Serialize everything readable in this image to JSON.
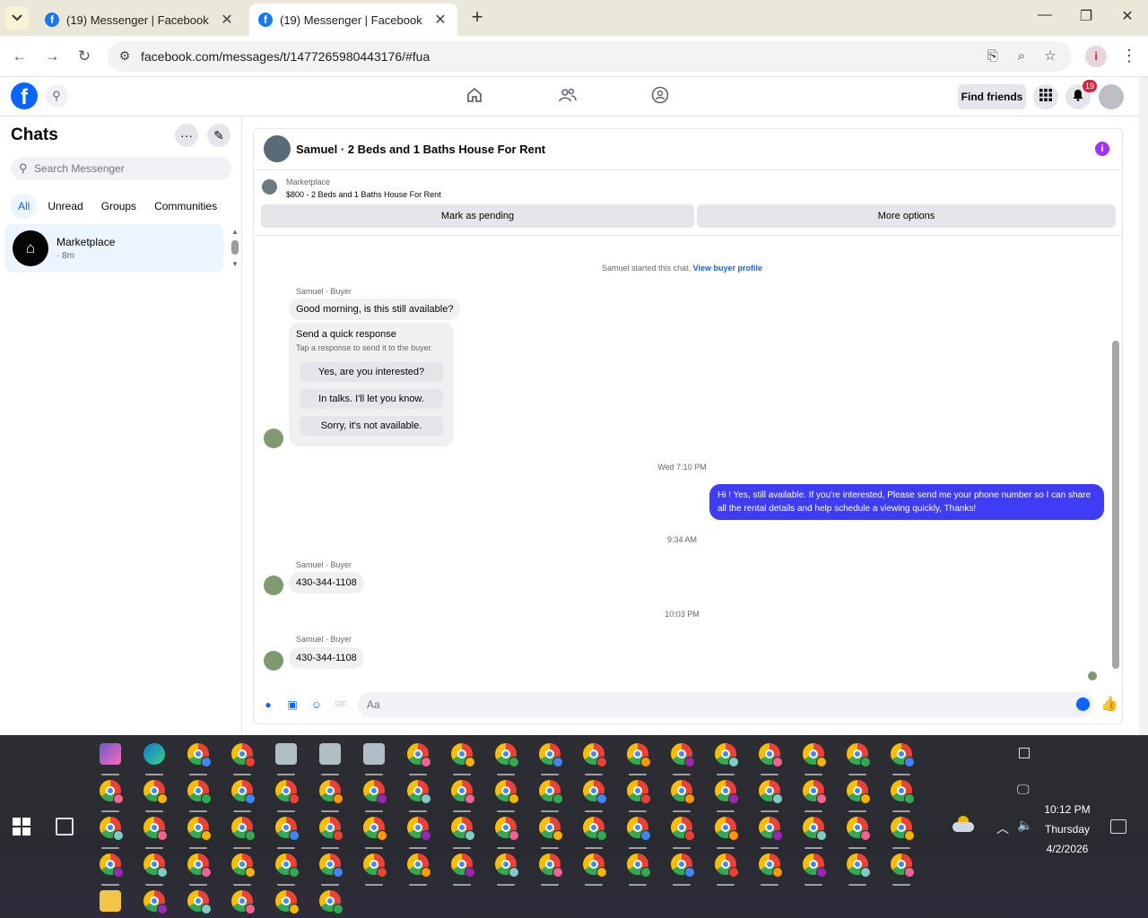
{
  "browser": {
    "tabs": [
      {
        "title": "(19) Messenger | Facebook",
        "active": false
      },
      {
        "title": "(19) Messenger | Facebook",
        "active": true
      }
    ],
    "url": "facebook.com/messages/t/1477265980443176/#fua",
    "new_tab": "+",
    "close": "✕"
  },
  "fb_header": {
    "logo": "f",
    "find_friends": "Find friends",
    "notification_count": "19",
    "nav_icons": [
      "home-icon",
      "friends-icon",
      "groups-icon"
    ]
  },
  "sidebar": {
    "title": "Chats",
    "search_placeholder": "Search Messenger",
    "filters": [
      "All",
      "Unread",
      "Groups",
      "Communities"
    ],
    "active_filter": "All",
    "chats": [
      {
        "name": "Marketplace",
        "time": "· 8m"
      }
    ]
  },
  "conversation": {
    "title": "Samuel · 2 Beds and 1 Baths House For Rent",
    "marketplace_label": "Marketplace",
    "listing": "$800 - 2 Beds and 1 Baths House For Rent",
    "mark_pending": "Mark as pending",
    "more_options": "More options",
    "system_text": "Samuel started this chat.",
    "system_link": "View buyer profile",
    "messages": {
      "m1_sender": "Samuel · Buyer",
      "m1_text": "Good morning, is this still available?",
      "quick_title": "Send a quick response",
      "quick_sub": "Tap a response to send it to the buyer.",
      "quick_replies": [
        "Yes, are you interested?",
        "In talks. I'll let you know.",
        "Sorry, it's not available."
      ],
      "ts1": "Wed 7:10 PM",
      "m2_text": "Hi ! Yes, still available. If you're interested, Please send me your phone number so I can share all the rental details and help schedule a viewing quickly, Thanks!",
      "ts2": "9:34 AM",
      "m3_sender": "Samuel · Buyer",
      "m3_text": "430-344-1108",
      "ts3": "10:03 PM",
      "m4_sender": "Samuel · Buyer",
      "m4_text": "430-344-1108"
    },
    "composer_placeholder": "Aa"
  },
  "taskbar": {
    "clock_time": "10:12 PM",
    "clock_day": "Thursday",
    "clock_date": "4/2/2026"
  }
}
